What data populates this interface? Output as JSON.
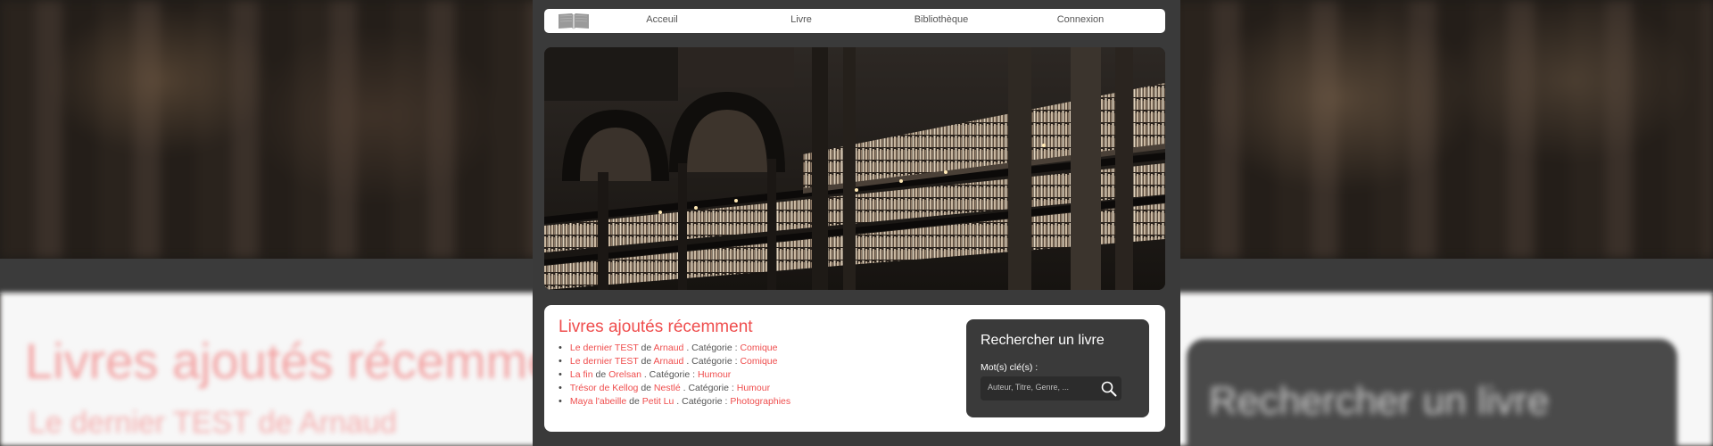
{
  "nav": {
    "logo_icon": "open-book-icon",
    "items": [
      {
        "label": "Acceuil"
      },
      {
        "label": "Livre"
      },
      {
        "label": "Bibliothèque"
      },
      {
        "label": "Connexion"
      }
    ]
  },
  "hero": {
    "image": "library-interior-photo"
  },
  "recent": {
    "title": "Livres ajoutés récemment",
    "books": [
      {
        "title": "Le dernier TEST",
        "de": "de",
        "author": "Arnaud",
        "cat_label": ". Catégorie :",
        "category": "Comique"
      },
      {
        "title": "Le dernier TEST",
        "de": "de",
        "author": "Arnaud",
        "cat_label": ". Catégorie :",
        "category": "Comique"
      },
      {
        "title": "La fin",
        "de": "de",
        "author": "Orelsan",
        "cat_label": ". Catégorie :",
        "category": "Humour"
      },
      {
        "title": "Trésor de Kellog",
        "de": "de",
        "author": "Nestlé",
        "cat_label": ". Catégorie :",
        "category": "Humour"
      },
      {
        "title": "Maya l'abeille",
        "de": "de",
        "author": "Petit Lu",
        "cat_label": ". Catégorie :",
        "category": "Photographies"
      }
    ]
  },
  "search": {
    "title": "Rechercher un livre",
    "label": "Mot(s) clé(s) :",
    "placeholder": "Auteur, Titre, Genre, ...",
    "icon": "search-icon"
  },
  "colors": {
    "accent": "#ef4d4d",
    "dark_panel": "#3a3a3a",
    "nav_bg": "#ffffff"
  }
}
